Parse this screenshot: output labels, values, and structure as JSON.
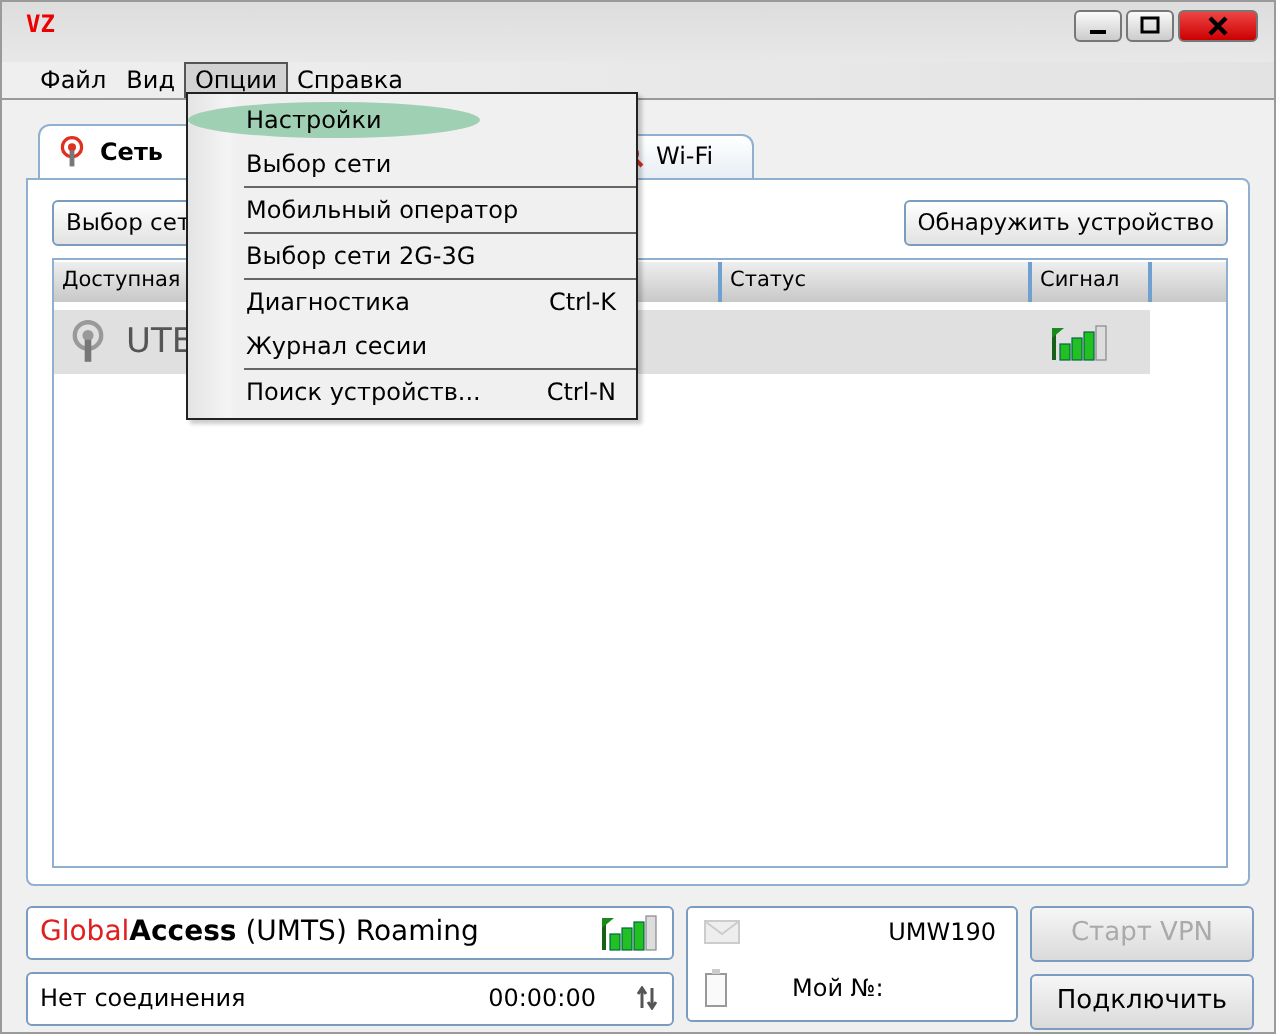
{
  "window": {
    "title": "VZ"
  },
  "menubar": [
    {
      "label": "Файл",
      "selected": false
    },
    {
      "label": "Вид",
      "selected": false
    },
    {
      "label": "Опции",
      "selected": true
    },
    {
      "label": "Справка",
      "selected": false
    }
  ],
  "menu": {
    "groups": [
      [
        {
          "label": "Настройки",
          "selected": true
        },
        {
          "label": "Выбор сети",
          "selected": false
        }
      ],
      [
        {
          "label": "Мобильный оператор",
          "selected": false
        }
      ],
      [
        {
          "label": "Выбор сети 2G-3G",
          "selected": false
        }
      ],
      [
        {
          "label": "Диагностика",
          "shortcut": "Ctrl-K",
          "selected": false
        },
        {
          "label": "Журнал сесии",
          "selected": false
        }
      ],
      [
        {
          "label": "Поиск устройств...",
          "shortcut": "Ctrl-N",
          "selected": false
        }
      ]
    ]
  },
  "tabs": [
    {
      "label": "Сеть",
      "selected": true
    },
    {
      "label": "Wi-Fi",
      "selected": false
    }
  ],
  "toolbar": {
    "left_button": "Выбор сет",
    "right_button": "Обнаружить устройство"
  },
  "table": {
    "columns": [
      "Доступная",
      "Статус",
      "Сигнал"
    ],
    "rows": [
      {
        "name": "UTE",
        "selected": true
      }
    ]
  },
  "status": {
    "operator_prefix": "Global",
    "operator_brand": "Access",
    "operator_rest": "(UMTS) Roaming",
    "connection": "Нет соединения",
    "timer": "00:00:00",
    "device": "UMW190",
    "my_number": "Мой №:"
  },
  "buttons": [
    {
      "label": "Старт VPN",
      "disabled": true
    },
    {
      "label": "Подключить",
      "disabled": false
    }
  ]
}
